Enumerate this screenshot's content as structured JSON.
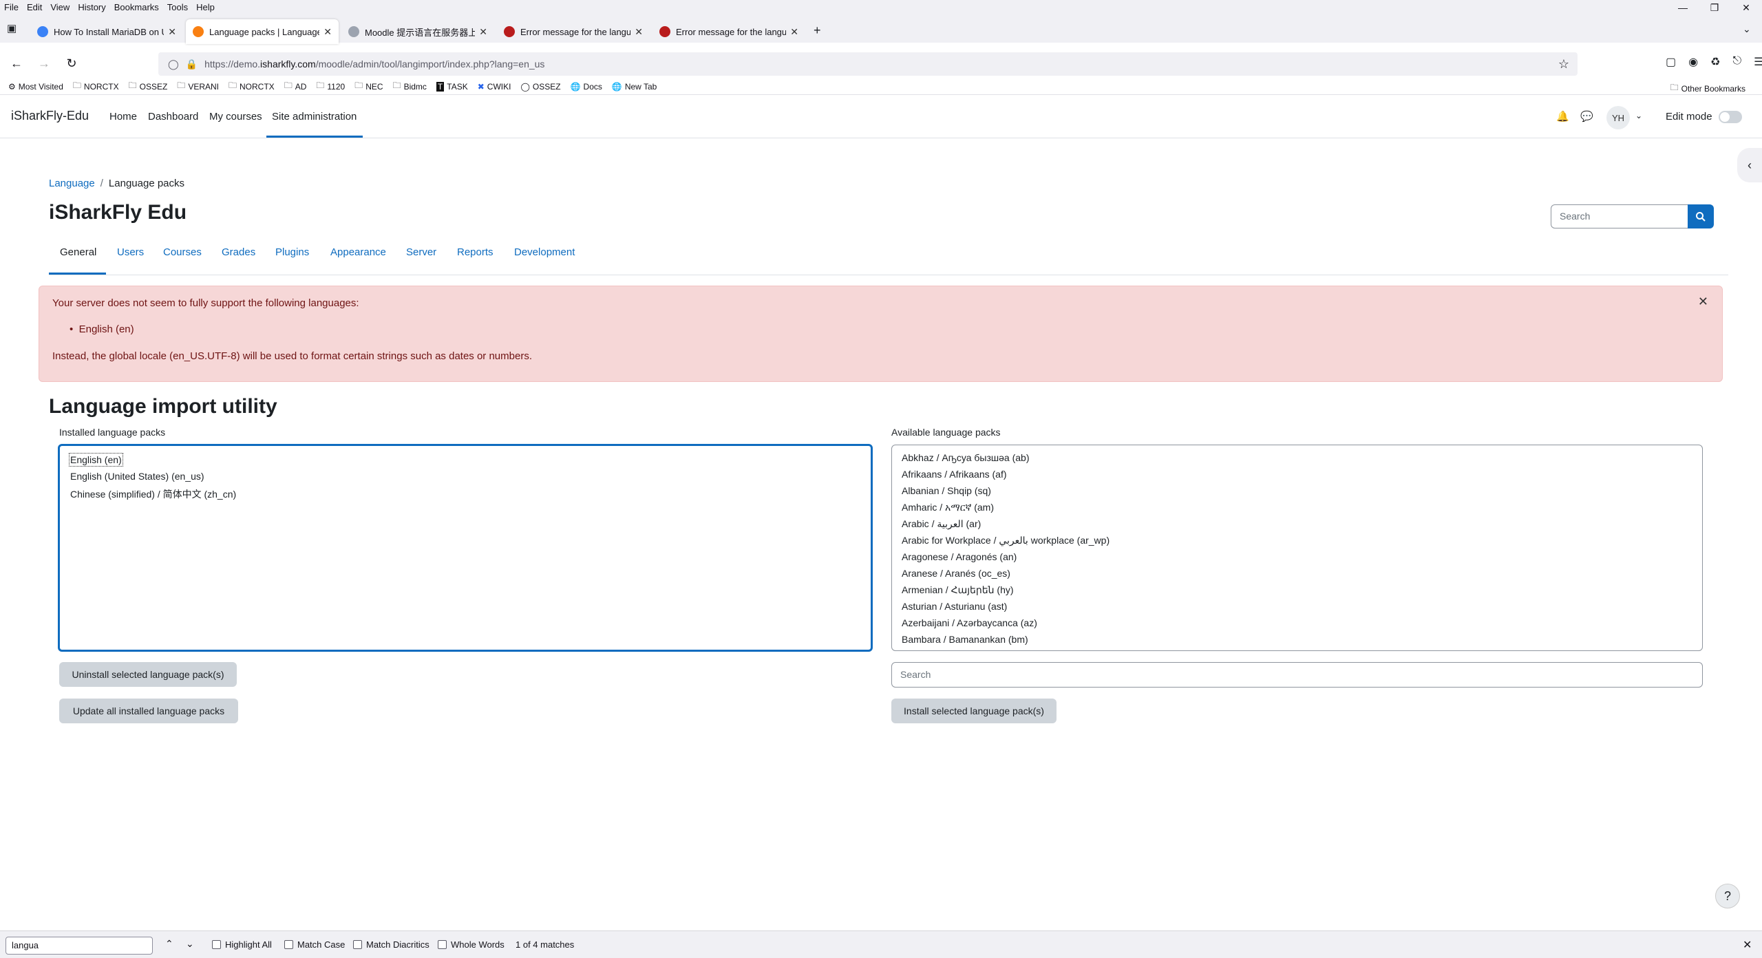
{
  "browser": {
    "menu": [
      "File",
      "Edit",
      "View",
      "History",
      "Bookmarks",
      "Tools",
      "Help"
    ],
    "tabs": [
      {
        "label": "How To Install MariaDB on Ubu",
        "favicon_color": "#3b82f6"
      },
      {
        "label": "Language packs | Language | A:",
        "favicon_color": "#f98012"
      },
      {
        "label": "Moodle 提示语言在服务器上不",
        "favicon_color": "#9ca3af"
      },
      {
        "label": "Error message for the language",
        "favicon_color": "#b91c1c"
      },
      {
        "label": "Error message for the language",
        "favicon_color": "#b91c1c"
      }
    ],
    "url_prefix": "https://demo.",
    "url_host": "isharkfly.com",
    "url_path": "/moodle/admin/tool/langimport/index.php?lang=en_us",
    "bookmarks": [
      "Most Visited",
      "NORCTX",
      "OSSEZ",
      "VERANI",
      "NORCTX",
      "AD",
      "1120",
      "NEC",
      "Bidmc",
      "TASK",
      "CWIKI",
      "OSSEZ",
      "Docs",
      "New Tab"
    ],
    "other_bookmarks": "Other Bookmarks"
  },
  "moodle": {
    "site_name": "iSharkFly-Edu",
    "primary_nav": [
      "Home",
      "Dashboard",
      "My courses",
      "Site administration"
    ],
    "user_initials": "YH",
    "edit_mode_label": "Edit mode",
    "breadcrumb": {
      "parent": "Language",
      "current": "Language packs"
    },
    "page_title": "iSharkFly Edu",
    "search_placeholder": "Search",
    "secondary_tabs": [
      "General",
      "Users",
      "Courses",
      "Grades",
      "Plugins",
      "Appearance",
      "Server",
      "Reports",
      "Development"
    ],
    "alert": {
      "intro": "Your server does not seem to fully support the following languages:",
      "item": "English (en)",
      "outro": "Instead, the global locale (en_US.UTF-8) will be used to format certain strings such as dates or numbers."
    },
    "utility_title": "Language import utility",
    "installed_label": "Installed language packs",
    "installed_packs": [
      "English (en)",
      "English (United States) (en_us)",
      "Chinese (simplified) / 简体中文 (zh_cn)"
    ],
    "available_label": "Available language packs",
    "available_packs": [
      "Abkhaz / Аҧсуа бызшәа (ab)",
      "Afrikaans / Afrikaans (af)",
      "Albanian / Shqip (sq)",
      "Amharic / አማርኛ (am)",
      "Arabic / العربية (ar)",
      "Arabic for Workplace / بالعربي workplace (ar_wp)",
      "Aragonese / Aragonés (an)",
      "Aranese / Aranés (oc_es)",
      "Armenian / Հայերեն (hy)",
      "Asturian / Asturianu (ast)",
      "Azerbaijani / Azərbaycanca (az)",
      "Bambara / Bamanankan (bm)"
    ],
    "uninstall_button": "Uninstall selected language pack(s)",
    "update_button": "Update all installed language packs",
    "available_search_placeholder": "Search",
    "install_button": "Install selected language pack(s)",
    "help_glyph": "?"
  },
  "findbar": {
    "query": "langua",
    "options": [
      "Highlight All",
      "Match Case",
      "Match Diacritics",
      "Whole Words"
    ],
    "matches": "1 of 4 matches"
  },
  "colors": {
    "brand": "#0f6cbf",
    "alert_bg": "#f6d7d7",
    "alert_text": "#6e1313"
  }
}
